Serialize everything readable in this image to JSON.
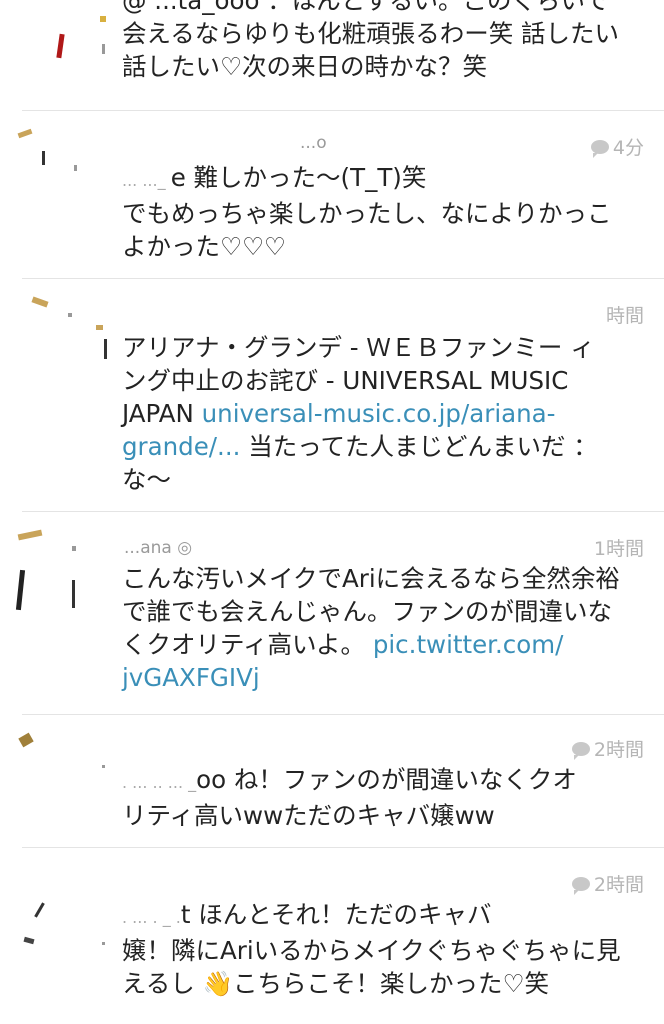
{
  "tweets": [
    {
      "line1": "@ ...ta_ooo ：ほんとするい。このくらいで",
      "line2": "会えるならゆりも化粧頑張るわー笑 話したい",
      "line3": "話したい♡次の来日の時かな？笑"
    },
    {
      "time": "4分",
      "name": "...o",
      "line1_prefix": "... ..._ ",
      "line1": "e 難しかった〜(T_T)笑",
      "line2": "でもめっちゃ楽しかったし、なによりかっこ",
      "line3": "よかった♡♡♡"
    },
    {
      "time": "時間",
      "line1": "アリアナ・グランデ - ＷＥＢファンミー ィ",
      "line2": "ング中止のお詫び - UNIVERSAL MUSIC",
      "line3_text": "JAPAN ",
      "line3_link": "universal-music.co.jp/ariana-",
      "line4_link": "grande/...",
      "line4_text": " 当たってた人まじどんまいだ ：",
      "line5": "な〜"
    },
    {
      "time": "1時間",
      "name": "...ana ◎",
      "line1": "こんな汚いメイクでAriに会えるなら全然余裕",
      "line2": "で誰でも会えんじゃん。ファンのが間違いな",
      "line3_text": "くクオリティ高いよ。 ",
      "line3_link": "pic.twitter.com/",
      "line4_link": "jvGAXFGIVj"
    },
    {
      "time": "2時間",
      "line1_prefix": ". ... .. ... _",
      "line1": "oo ね！ファンのが間違いなくクオ",
      "line2": "リティ高いwwただのキャバ嬢ww"
    },
    {
      "time": "2時間",
      "line1_prefix": ". ... . _ .",
      "line1": "t ほんとそれ！ただのキャバ",
      "line2": "嬢！隣にAriいるからメイクぐちゃぐちゃに見",
      "line3": "えるし 👋こちらこそ！楽しかった♡笑"
    }
  ]
}
